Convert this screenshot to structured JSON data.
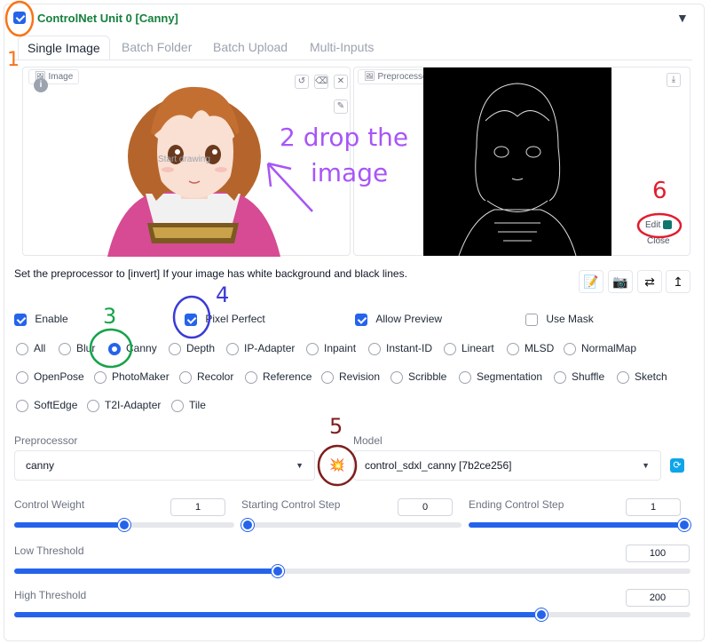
{
  "header": {
    "title": "ControlNet Unit 0 [Canny]",
    "collapse_icon": "triangle-down-icon"
  },
  "tabs": [
    {
      "label": "Single Image",
      "active": true
    },
    {
      "label": "Batch Folder",
      "active": false
    },
    {
      "label": "Batch Upload",
      "active": false
    },
    {
      "label": "Multi-Inputs",
      "active": false
    }
  ],
  "image_panel": {
    "label": "Image",
    "overlay_text": "Start drawing",
    "tools": [
      "undo-icon",
      "eraser-icon",
      "close-icon",
      "brush-icon"
    ]
  },
  "preview_panel": {
    "label": "Preprocessor Preview",
    "edit_label": "Edit",
    "close_label": "Close"
  },
  "note": "Set the preprocessor to [invert] If your image has white background and black lines.",
  "toolbar": [
    "notes-icon",
    "camera-icon",
    "swap-icon",
    "send-icon"
  ],
  "options": {
    "enable": {
      "label": "Enable",
      "checked": true
    },
    "pixel_perfect": {
      "label": "Pixel Perfect",
      "checked": true
    },
    "allow_preview": {
      "label": "Allow Preview",
      "checked": true
    },
    "use_mask": {
      "label": "Use Mask",
      "checked": false
    }
  },
  "control_types": [
    "All",
    "Blur",
    "Canny",
    "Depth",
    "IP-Adapter",
    "Inpaint",
    "Instant-ID",
    "Lineart",
    "MLSD",
    "NormalMap",
    "OpenPose",
    "PhotoMaker",
    "Recolor",
    "Reference",
    "Revision",
    "Scribble",
    "Segmentation",
    "Shuffle",
    "Sketch",
    "SoftEdge",
    "T2I-Adapter",
    "Tile"
  ],
  "selected_control_type": "Canny",
  "preprocessor": {
    "label": "Preprocessor",
    "value": "canny"
  },
  "model": {
    "label": "Model",
    "value": "control_sdxl_canny [7b2ce256]"
  },
  "sliders": {
    "control_weight": {
      "label": "Control Weight",
      "value": "1",
      "min": 0,
      "max": 2
    },
    "start_step": {
      "label": "Starting Control Step",
      "value": "0",
      "min": 0,
      "max": 1
    },
    "end_step": {
      "label": "Ending Control Step",
      "value": "1",
      "min": 0,
      "max": 1
    },
    "low_threshold": {
      "label": "Low Threshold",
      "value": "100",
      "min": 1,
      "max": 255
    },
    "high_threshold": {
      "label": "High Threshold",
      "value": "200",
      "min": 1,
      "max": 255
    }
  },
  "annotations": {
    "n1": "1",
    "n2_text": "2  drop the",
    "n2_text2": "image",
    "n3": "3",
    "n4": "4",
    "n5": "5",
    "n6": "6"
  },
  "colors": {
    "accent": "#2563eb",
    "title_green": "#15803d",
    "annot_orange": "#f97316",
    "annot_purple": "#a855f7",
    "annot_green": "#16a34a",
    "annot_blue": "#3b3bd6",
    "annot_darkred": "#7f1d1d",
    "annot_red": "#e11d2e"
  }
}
